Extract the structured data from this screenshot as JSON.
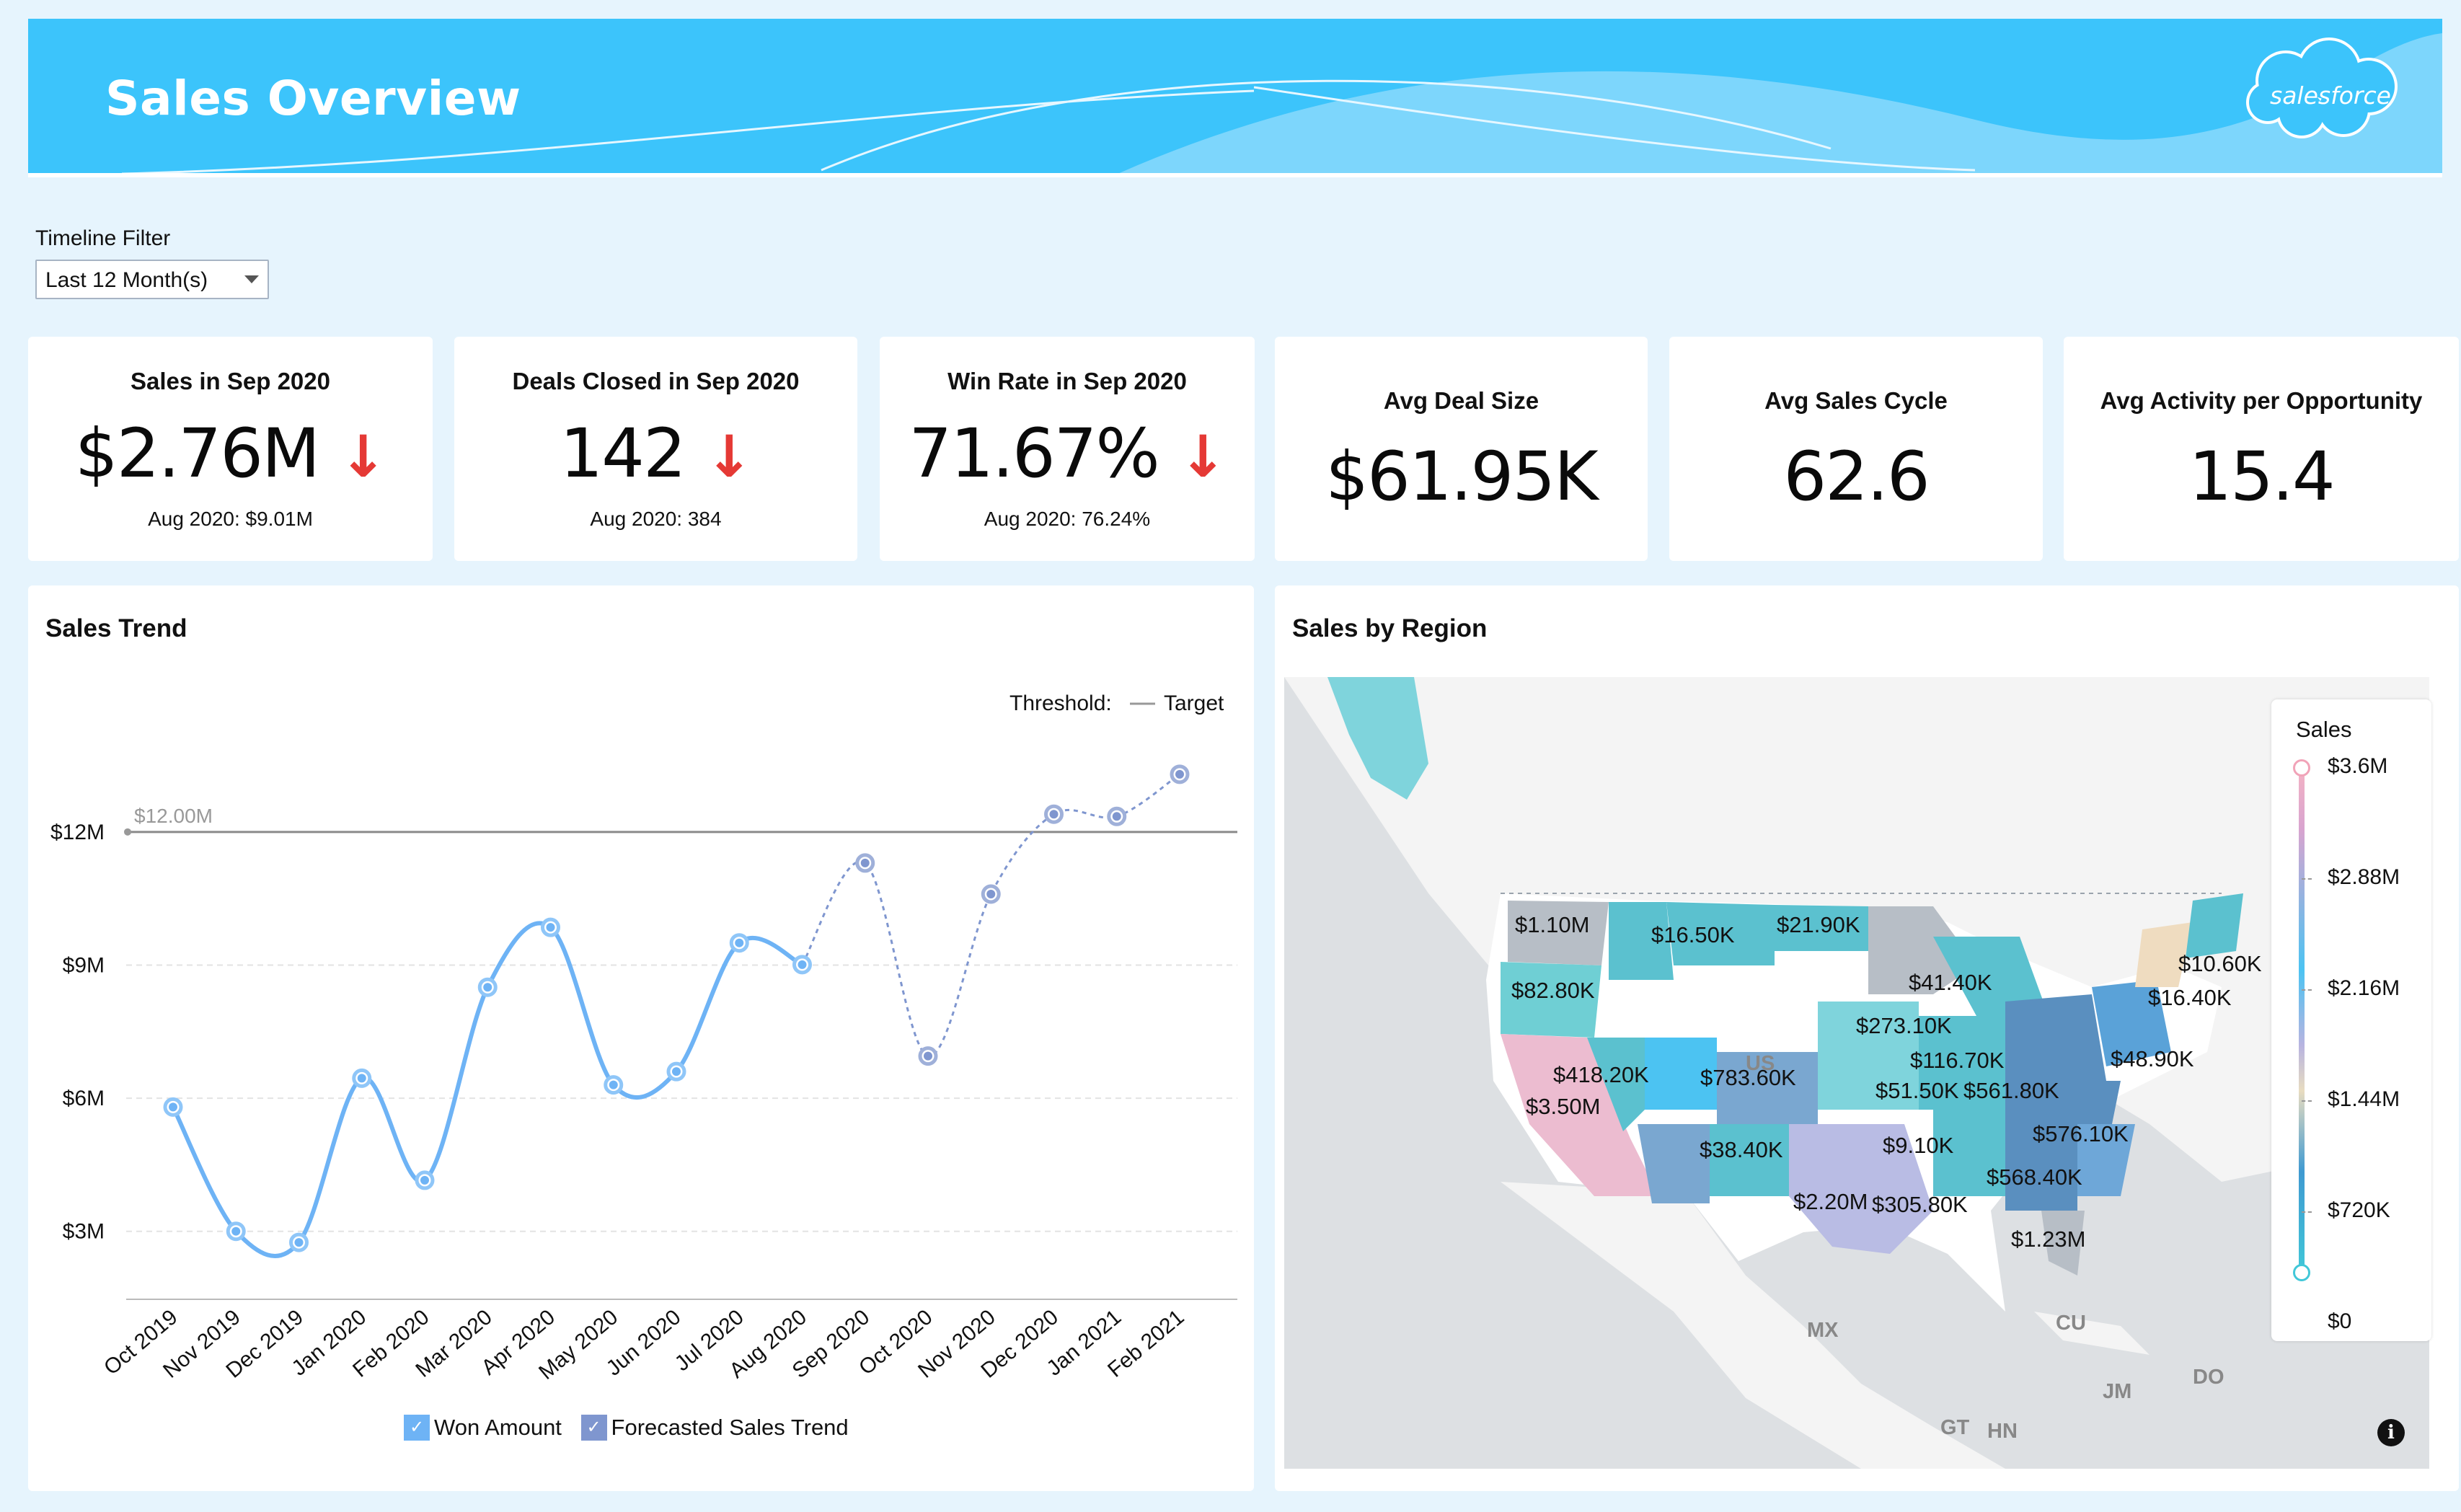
{
  "header": {
    "title": "Sales Overview",
    "logo_text": "salesforce",
    "colors": {
      "banner": "#3cc4fb",
      "text": "#ffffff"
    }
  },
  "filter": {
    "label": "Timeline Filter",
    "selected": "Last 12 Month(s)"
  },
  "kpis": [
    {
      "title": "Sales in Sep 2020",
      "value": "$2.76M",
      "trend": "down",
      "sub": "Aug 2020: $9.01M"
    },
    {
      "title": "Deals Closed in Sep 2020",
      "value": "142",
      "trend": "down",
      "sub": "Aug 2020: 384"
    },
    {
      "title": "Win Rate in Sep 2020",
      "value": "71.67%",
      "trend": "down",
      "sub": "Aug 2020: 76.24%"
    },
    {
      "title": "Avg Deal Size",
      "value": "$61.95K"
    },
    {
      "title": "Avg Sales Cycle",
      "value": "62.6"
    },
    {
      "title": "Avg Activity per Opportunity",
      "value": "15.4"
    }
  ],
  "kpi_arrow": "↓",
  "sales_trend": {
    "title": "Sales Trend",
    "threshold_label": "Threshold:",
    "threshold_series": "Target",
    "target_label": "$12.00M",
    "legend": [
      "Won Amount",
      "Forecasted Sales Trend"
    ]
  },
  "chart_data": {
    "type": "line",
    "categories": [
      "Oct 2019",
      "Nov 2019",
      "Dec 2019",
      "Jan 2020",
      "Feb 2020",
      "Mar 2020",
      "Apr 2020",
      "May 2020",
      "Jun 2020",
      "Jul 2020",
      "Aug 2020",
      "Sep 2020",
      "Oct 2020",
      "Nov 2020",
      "Dec 2020",
      "Jan 2021",
      "Feb 2021"
    ],
    "y_ticks": [
      "$3M",
      "$6M",
      "$9M",
      "$12M"
    ],
    "ylim": [
      1.5,
      14.5
    ],
    "target": 12.0,
    "series": [
      {
        "name": "Won Amount",
        "color": "#6eb3f5",
        "values": [
          5.8,
          3.0,
          2.75,
          6.45,
          4.15,
          8.5,
          9.85,
          6.3,
          6.6,
          9.5,
          9.01,
          null,
          null,
          null,
          null,
          null,
          null
        ]
      },
      {
        "name": "Forecasted Sales Trend",
        "color": "#7f96cf",
        "values": [
          null,
          null,
          null,
          null,
          null,
          null,
          null,
          null,
          null,
          null,
          9.01,
          11.3,
          6.95,
          10.6,
          12.4,
          12.35,
          13.3
        ]
      }
    ]
  },
  "sales_region": {
    "title": "Sales by Region",
    "state_labels": [
      "$1.10M",
      "$16.50K",
      "$21.90K",
      "$82.80K",
      "$41.40K",
      "$10.60K",
      "$16.40K",
      "$273.10K",
      "$418.20K",
      "$783.60K",
      "$116.70K",
      "$48.90K",
      "$3.50M",
      "$51.50K",
      "$561.80K",
      "$576.10K",
      "$38.40K",
      "$9.10K",
      "$568.40K",
      "$2.20M",
      "$305.80K",
      "$1.23M"
    ],
    "countries": [
      "US",
      "MX",
      "CU",
      "JM",
      "DO",
      "GT",
      "HN"
    ],
    "legend_title": "Sales",
    "legend_values": [
      "$3.6M",
      "$2.88M",
      "$2.16M",
      "$1.44M",
      "$720K",
      "$0"
    ]
  }
}
